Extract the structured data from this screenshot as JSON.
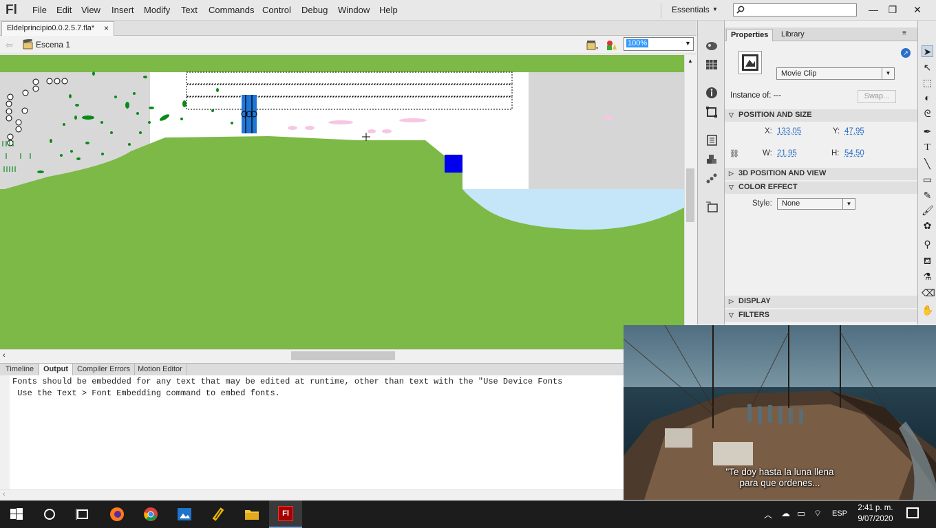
{
  "app": {
    "logo": "Fl",
    "workspace": "Essentials"
  },
  "menu": [
    "File",
    "Edit",
    "View",
    "Insert",
    "Modify",
    "Text",
    "Commands",
    "Control",
    "Debug",
    "Window",
    "Help"
  ],
  "window_controls": {
    "minimize": "—",
    "restore": "❐",
    "close": "✕"
  },
  "document": {
    "tab_label": "Eldelprincipio0.0.2.5.7.fla*",
    "close": "×"
  },
  "scene": {
    "label": "Escena 1",
    "zoom": "100%"
  },
  "bottom_tabs": [
    "Timeline",
    "Output",
    "Compiler Errors",
    "Motion Editor"
  ],
  "active_bottom_tab": "Output",
  "output_lines": [
    "Fonts should be embedded for any text that may be edited at runtime, other than text with the \"Use Device Fonts",
    " Use the Text > Font Embedding command to embed fonts."
  ],
  "properties": {
    "tabs": [
      "Properties",
      "Library"
    ],
    "symbol_type": "Movie Clip",
    "instance_label": "Instance of:",
    "instance_value": "---",
    "swap_button": "Swap...",
    "sections": {
      "position_size": "POSITION AND SIZE",
      "position_3d": "3D POSITION AND VIEW",
      "color_effect": "COLOR EFFECT",
      "display": "DISPLAY",
      "filters": "FILTERS"
    },
    "x_label": "X:",
    "x": "133,05",
    "y_label": "Y:",
    "y": "47,95",
    "w_label": "W:",
    "w": "21,95",
    "h_label": "H:",
    "h": "54,50",
    "style_label": "Style:",
    "style_value": "None"
  },
  "video": {
    "subtitle_line1": "\"Te doy hasta la luna llena",
    "subtitle_line2": "para que ordenes..."
  },
  "taskbar": {
    "language": "ESP",
    "time": "2:41 p. m.",
    "date": "9/07/2020"
  },
  "colors": {
    "stage_green": "#7db946",
    "water": "#c5e6f9",
    "selection_blue": "#3399ff",
    "taskbar": "#1c1c1c"
  }
}
